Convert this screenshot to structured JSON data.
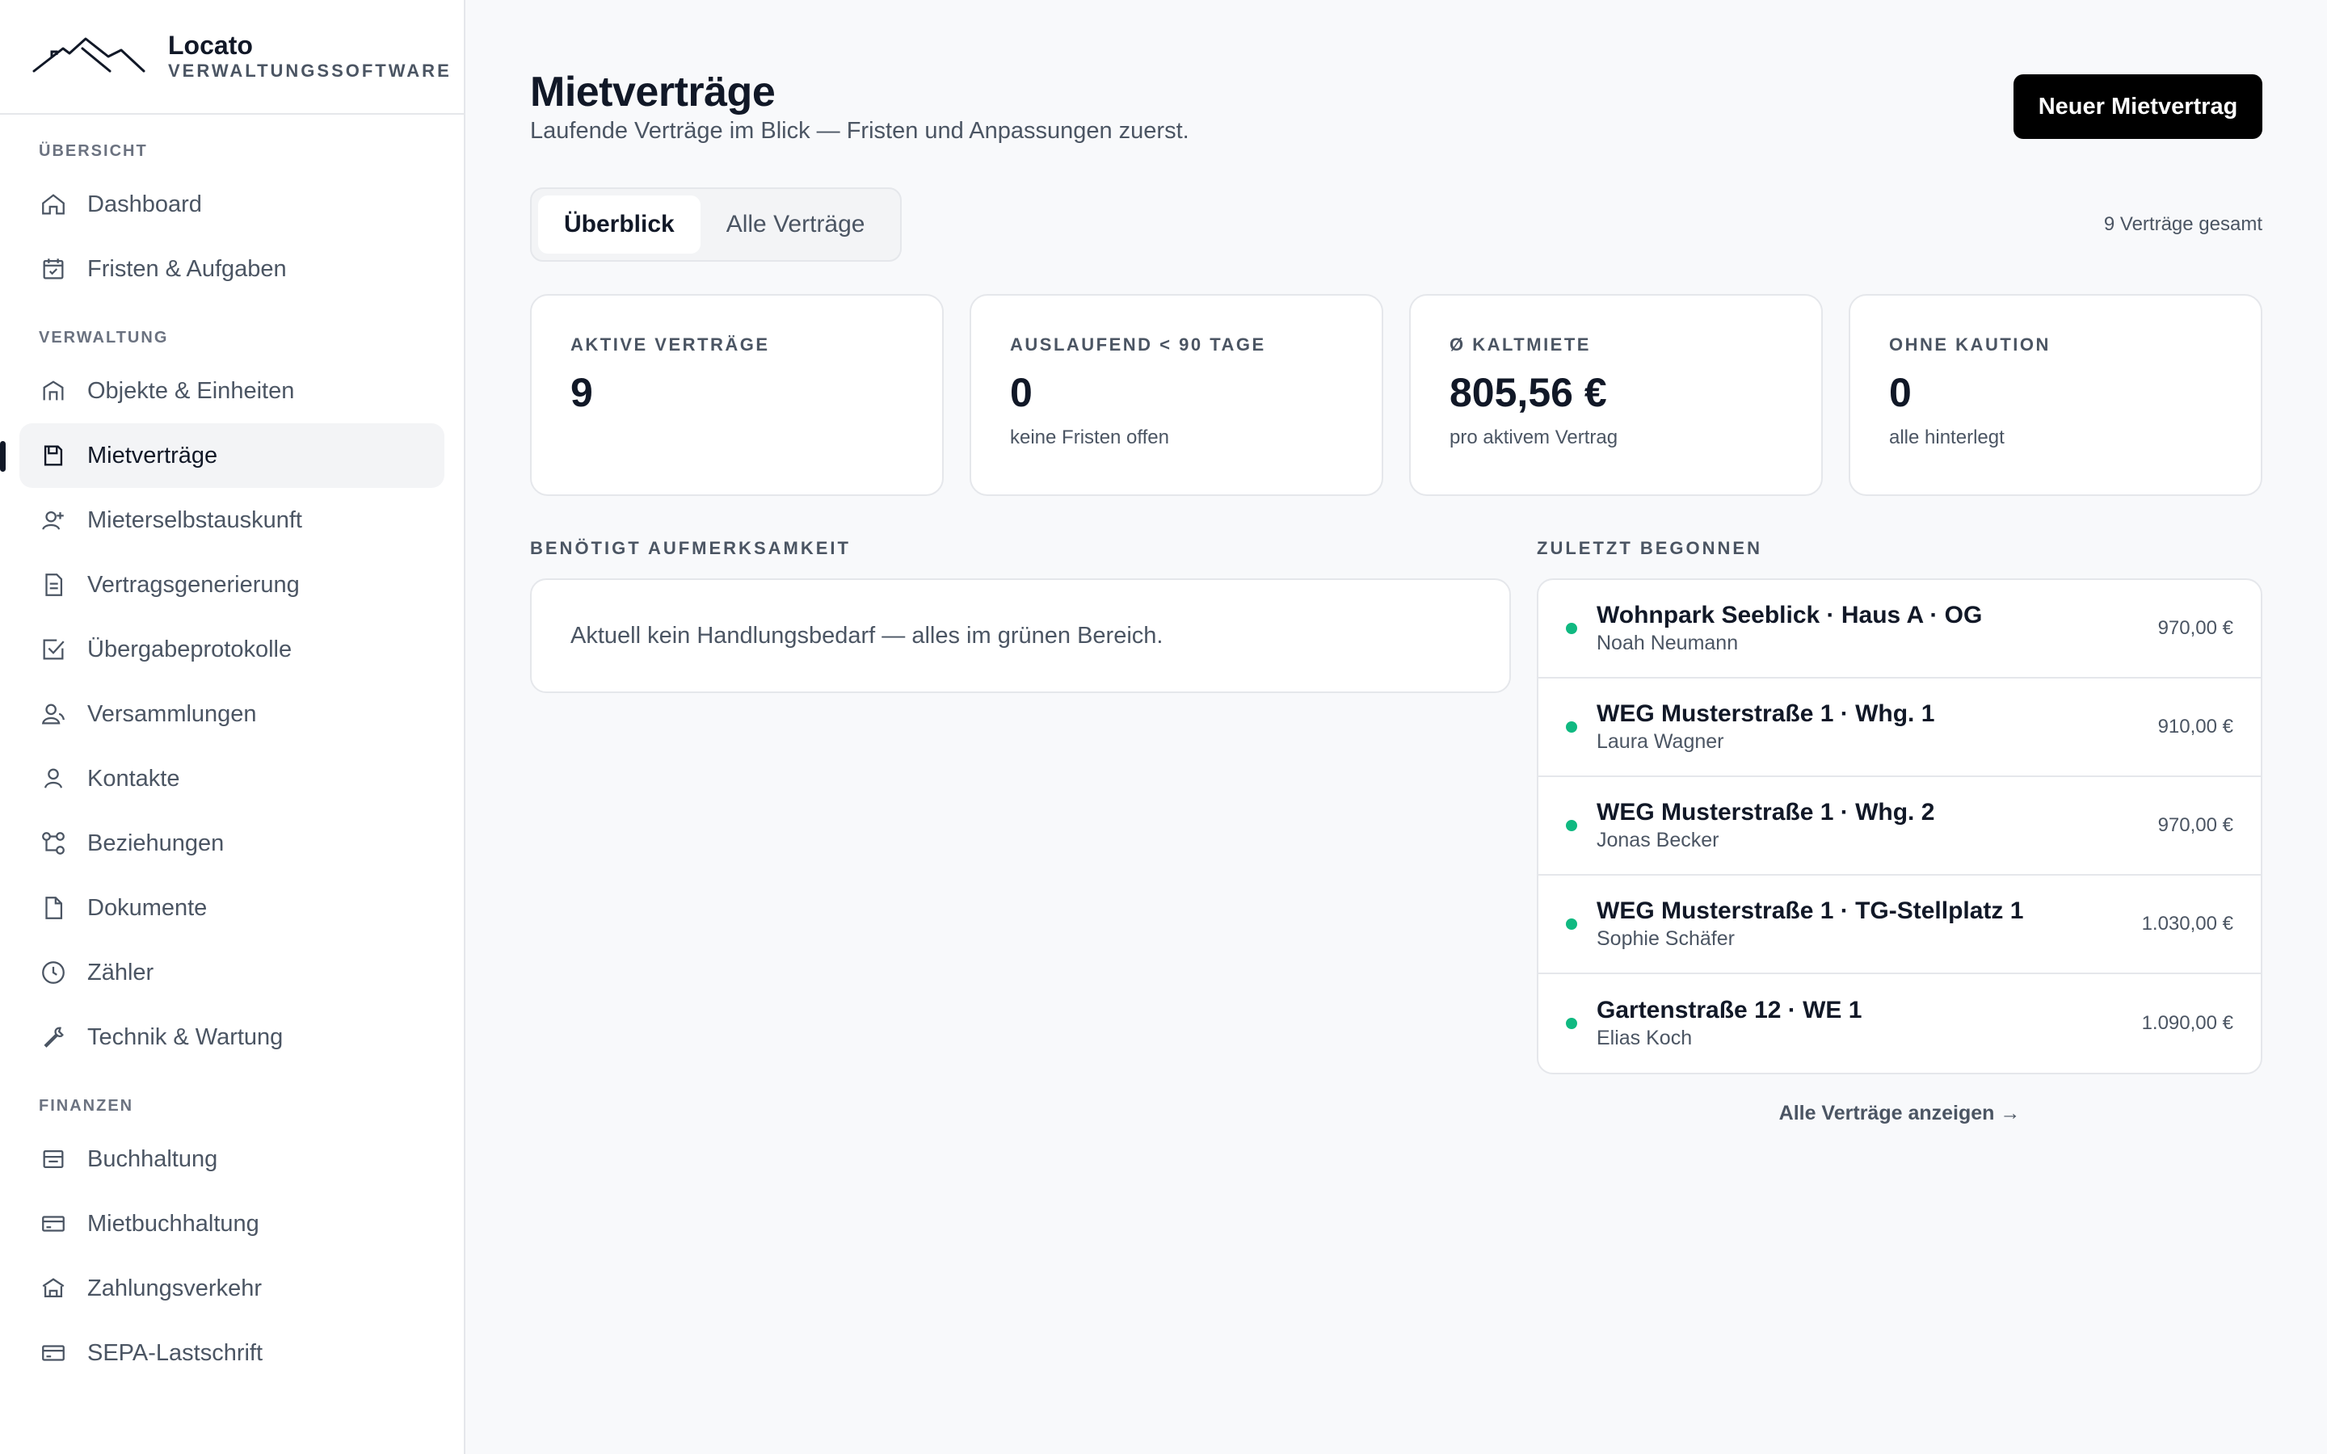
{
  "brand": {
    "name": "Locato",
    "subtitle": "VERWALTUNGSSOFTWARE"
  },
  "sidebar": {
    "sections": [
      {
        "label": "ÜBERSICHT",
        "items": [
          {
            "label": "Dashboard",
            "icon": "home-icon"
          },
          {
            "label": "Fristen & Aufgaben",
            "icon": "calendar-check-icon"
          }
        ]
      },
      {
        "label": "VERWALTUNG",
        "items": [
          {
            "label": "Objekte & Einheiten",
            "icon": "building-icon"
          },
          {
            "label": "Mietverträge",
            "icon": "contract-icon",
            "active": true
          },
          {
            "label": "Mieterselbstauskunft",
            "icon": "user-plus-icon"
          },
          {
            "label": "Vertragsgenerierung",
            "icon": "file-text-icon"
          },
          {
            "label": "Übergabeprotokolle",
            "icon": "checkbox-icon"
          },
          {
            "label": "Versammlungen",
            "icon": "users-icon"
          },
          {
            "label": "Kontakte",
            "icon": "user-icon"
          },
          {
            "label": "Beziehungen",
            "icon": "relations-icon"
          },
          {
            "label": "Dokumente",
            "icon": "document-icon"
          },
          {
            "label": "Zähler",
            "icon": "clock-icon"
          },
          {
            "label": "Technik & Wartung",
            "icon": "wrench-icon"
          }
        ]
      },
      {
        "label": "FINANZEN",
        "items": [
          {
            "label": "Buchhaltung",
            "icon": "ledger-icon"
          },
          {
            "label": "Mietbuchhaltung",
            "icon": "card-icon"
          },
          {
            "label": "Zahlungsverkehr",
            "icon": "bank-icon"
          },
          {
            "label": "SEPA-Lastschrift",
            "icon": "card-icon"
          }
        ]
      }
    ]
  },
  "header": {
    "title": "Mietverträge",
    "subtitle": "Laufende Verträge im Blick — Fristen und Anpassungen zuerst.",
    "new_button": "Neuer Mietvertrag"
  },
  "tabs": [
    {
      "label": "Überblick",
      "active": true
    },
    {
      "label": "Alle Verträge"
    }
  ],
  "total_count": "9 Verträge gesamt",
  "kpis": [
    {
      "label": "AKTIVE VERTRÄGE",
      "value": "9",
      "note": ""
    },
    {
      "label": "AUSLAUFEND < 90 TAGE",
      "value": "0",
      "note": "keine Fristen offen"
    },
    {
      "label": "Ø KALTMIETE",
      "value": "805,56 €",
      "note": "pro aktivem Vertrag"
    },
    {
      "label": "OHNE KAUTION",
      "value": "0",
      "note": "alle hinterlegt"
    }
  ],
  "attention": {
    "label": "BENÖTIGT AUFMERKSAMKEIT",
    "message": "Aktuell kein Handlungsbedarf — alles im grünen Bereich."
  },
  "recent": {
    "label": "ZULETZT BEGONNEN",
    "status_color": "#10b981",
    "items": [
      {
        "title": "Wohnpark Seeblick · Haus A · OG",
        "tenant": "Noah Neumann",
        "amount": "970,00 €"
      },
      {
        "title": "WEG Musterstraße 1 · Whg. 1",
        "tenant": "Laura Wagner",
        "amount": "910,00 €"
      },
      {
        "title": "WEG Musterstraße 1 · Whg. 2",
        "tenant": "Jonas Becker",
        "amount": "970,00 €"
      },
      {
        "title": "WEG Musterstraße 1 · TG-Stellplatz 1",
        "tenant": "Sophie Schäfer",
        "amount": "1.030,00 €"
      },
      {
        "title": "Gartenstraße 12 · WE 1",
        "tenant": "Elias Koch",
        "amount": "1.090,00 €"
      }
    ],
    "all_link": "Alle Verträge anzeigen →"
  }
}
